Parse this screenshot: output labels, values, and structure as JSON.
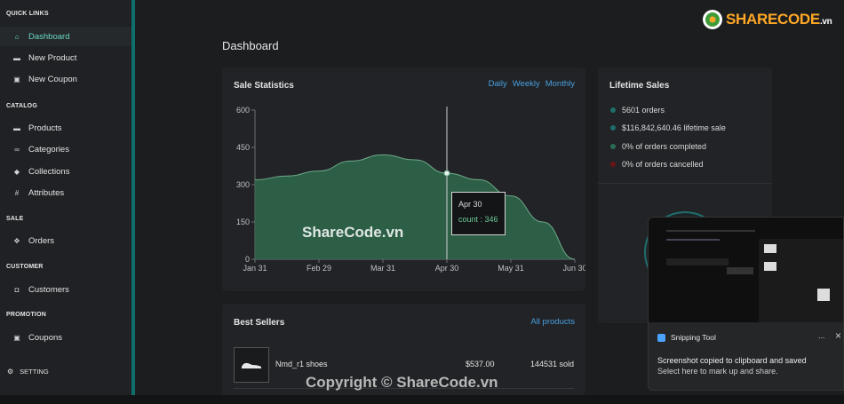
{
  "sidebar": {
    "sections": {
      "quick_links": "QUICK LINKS",
      "catalog": "CATALOG",
      "sale": "SALE",
      "customer": "CUSTOMER",
      "promotion": "PROMOTION"
    },
    "items": {
      "dashboard": "Dashboard",
      "new_product": "New Product",
      "new_coupon": "New Coupon",
      "products": "Products",
      "categories": "Categories",
      "collections": "Collections",
      "attributes": "Attributes",
      "orders": "Orders",
      "customers": "Customers",
      "coupons": "Coupons"
    },
    "setting": "SETTING",
    "active_color": "#66d7c4"
  },
  "page": {
    "title": "Dashboard"
  },
  "sale_statistics": {
    "title": "Sale Statistics",
    "tabs": [
      "Daily",
      "Weekly",
      "Monthly"
    ],
    "tooltip": {
      "date": "Apr 30",
      "label": "count : 346"
    }
  },
  "lifetime_sales": {
    "title": "Lifetime Sales",
    "items": [
      {
        "text": "5601 orders",
        "color": "#1f6d6a"
      },
      {
        "text": "$116,842,640.46 lifetime sale",
        "color": "#1f6d6a"
      },
      {
        "text": "0% of orders completed",
        "color": "#2a6f55"
      },
      {
        "text": "0% of orders cancelled",
        "color": "#6b1414"
      }
    ]
  },
  "best_sellers": {
    "title": "Best Sellers",
    "link": "All products",
    "rows": [
      {
        "name": "Nmd_r1 shoes",
        "price": "$537.00",
        "sold": "144531 sold"
      }
    ]
  },
  "snipping_tool": {
    "app": "Snipping Tool",
    "more": "...",
    "close": "×",
    "message": "Screenshot copied to clipboard and saved",
    "sub": "Select here to mark up and share."
  },
  "watermarks": {
    "center": "ShareCode.vn",
    "bottom": "Copyright © ShareCode.vn",
    "logo": "SHARECODE",
    "logo_suffix": ".vn"
  },
  "chart_data": {
    "type": "area",
    "x": [
      "Jan 31",
      "Feb 29",
      "Mar 31",
      "Apr 30",
      "May 31",
      "Jun 30"
    ],
    "xticks": [
      "Jan 31",
      "Feb 29",
      "Mar 31",
      "Apr 30",
      "May 31",
      "Jun 30"
    ],
    "yticks": [
      0,
      150,
      300,
      450,
      600
    ],
    "ylim": [
      0,
      600
    ],
    "points": [
      {
        "x": 0,
        "y": 320
      },
      {
        "x": 0.5,
        "y": 335
      },
      {
        "x": 1,
        "y": 355
      },
      {
        "x": 1.5,
        "y": 395
      },
      {
        "x": 2,
        "y": 420
      },
      {
        "x": 2.5,
        "y": 400
      },
      {
        "x": 3,
        "y": 346
      },
      {
        "x": 3.5,
        "y": 320
      },
      {
        "x": 4,
        "y": 255
      },
      {
        "x": 4.5,
        "y": 150
      },
      {
        "x": 5,
        "y": 0
      }
    ],
    "highlight": {
      "x": "Apr 30",
      "y": 346
    },
    "fill": "#2f6a4d",
    "grid": false
  }
}
